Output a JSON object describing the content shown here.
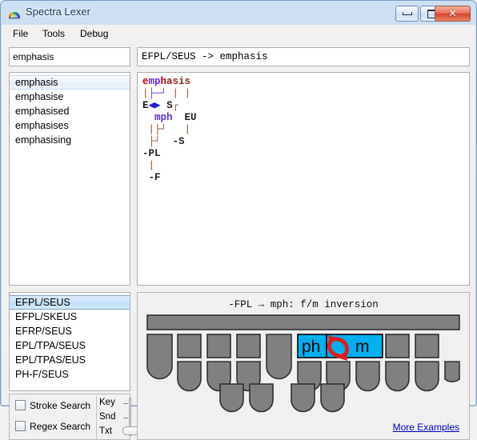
{
  "window": {
    "title": "Spectra Lexer",
    "icon": "app-icon",
    "buttons": {
      "minimize": "minimize",
      "maximize": "maximize",
      "close": "✕"
    }
  },
  "menubar": {
    "items": [
      {
        "label": "File"
      },
      {
        "label": "Tools"
      },
      {
        "label": "Debug"
      }
    ]
  },
  "search": {
    "value": "emphasis",
    "placeholder": "Search"
  },
  "translation": {
    "text": "EFPL/SEUS -> emphasis"
  },
  "match_list": {
    "items": [
      {
        "label": "emphasis",
        "selected": true
      },
      {
        "label": "emphasise",
        "selected": false
      },
      {
        "label": "emphasised",
        "selected": false
      },
      {
        "label": "emphasises",
        "selected": false
      },
      {
        "label": "emphasising",
        "selected": false
      }
    ]
  },
  "rule_list": {
    "items": [
      {
        "label": "EFPL/SEUS",
        "selected": true
      },
      {
        "label": "EFPL/SKEUS",
        "selected": false
      },
      {
        "label": "EFRP/SEUS",
        "selected": false
      },
      {
        "label": "EPL/TPA/SEUS",
        "selected": false
      },
      {
        "label": "EPL/TPAS/EUS",
        "selected": false
      },
      {
        "label": "PH-F/SEUS",
        "selected": false
      }
    ]
  },
  "graph": {
    "lines": [
      {
        "segments": [
          {
            "text": "e",
            "color": "red"
          },
          {
            "text": "mp",
            "color": "purple"
          },
          {
            "text": "h",
            "color": "red"
          },
          {
            "text": "asis",
            "color": "darkred"
          }
        ]
      },
      {
        "segments": [
          {
            "text": "|",
            "color": "brown"
          },
          {
            "text": "├─┘",
            "color": "purple"
          },
          {
            "text": " ",
            "color": "black"
          },
          {
            "text": "| |",
            "color": "brown"
          }
        ]
      },
      {
        "segments": [
          {
            "text": "E",
            "color": "black"
          },
          {
            "text": "◀▶",
            "color": "blue"
          },
          {
            "text": " S",
            "color": "black"
          },
          {
            "text": "┌",
            "color": "brown"
          }
        ]
      },
      {
        "segments": [
          {
            "text": "  ",
            "color": "black"
          },
          {
            "text": "mph",
            "color": "purple"
          },
          {
            "text": "  EU",
            "color": "black"
          }
        ]
      },
      {
        "segments": [
          {
            "text": " |├┘",
            "color": "brown"
          },
          {
            "text": "   |",
            "color": "brown"
          }
        ]
      },
      {
        "segments": [
          {
            "text": " ├┘",
            "color": "brown"
          },
          {
            "text": "  -S",
            "color": "black"
          }
        ]
      },
      {
        "segments": [
          {
            "text": "-PL",
            "color": "black"
          }
        ]
      },
      {
        "segments": [
          {
            "text": " |",
            "color": "brown"
          }
        ]
      },
      {
        "segments": [
          {
            "text": " -F",
            "color": "black"
          }
        ]
      }
    ]
  },
  "options": {
    "stroke_search": {
      "label": "Stroke Search",
      "checked": false
    },
    "regex_search": {
      "label": "Regex Search",
      "checked": false
    },
    "slider": {
      "labels": [
        "Key",
        "Snd",
        "Txt"
      ],
      "value": "Txt"
    }
  },
  "board": {
    "caption": "-FPL → mph: f/m inversion",
    "more_examples": "More Examples",
    "highlight_color": "#00b0f0",
    "key_color": "#808080",
    "arrow_color": "#e01b1b",
    "keys": {
      "top_bar": "number-bar",
      "left_labels": [
        "ph",
        "m"
      ]
    }
  }
}
